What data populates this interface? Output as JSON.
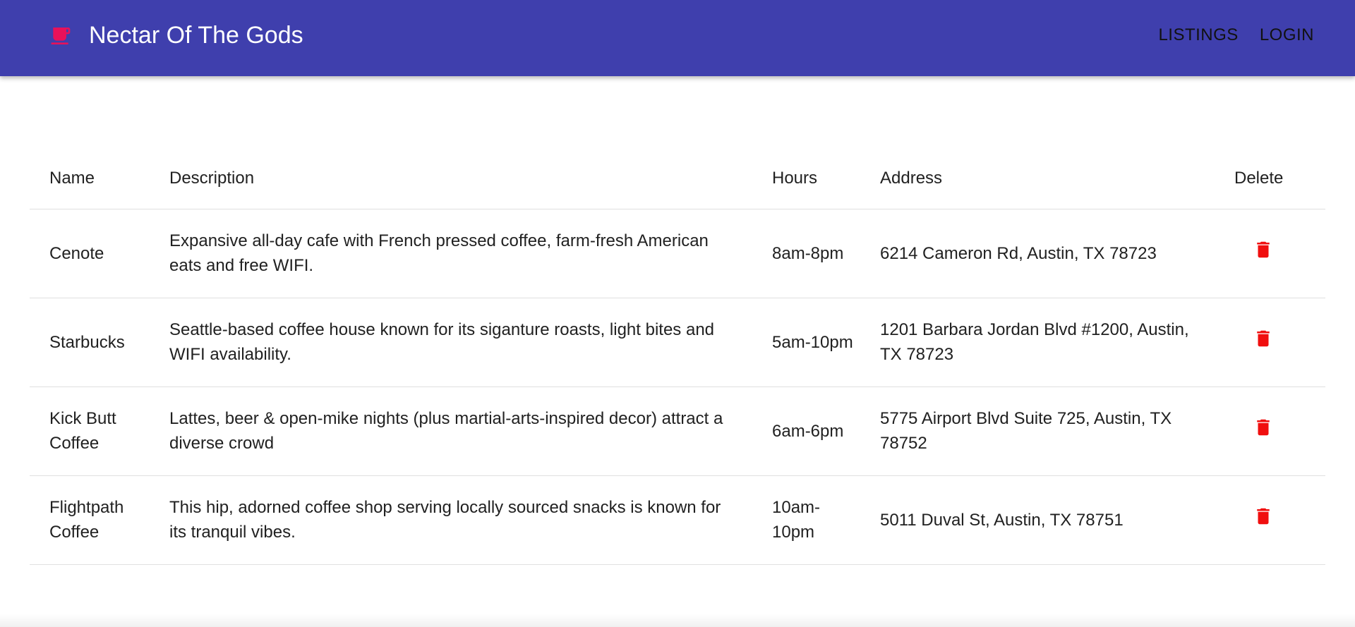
{
  "app": {
    "title": "Nectar Of The Gods",
    "brand_icon": "coffee-cup-icon",
    "colors": {
      "appbar": "#3f3fad",
      "brand_icon": "#e8115a",
      "delete_icon": "#f00f0f"
    }
  },
  "nav": {
    "listings_label": "LISTINGS",
    "login_label": "LOGIN"
  },
  "table": {
    "headers": {
      "name": "Name",
      "description": "Description",
      "hours": "Hours",
      "address": "Address",
      "delete": "Delete"
    },
    "rows": [
      {
        "name": "Cenote",
        "description": "Expansive all-day cafe with French pressed coffee, farm-fresh American eats and free WIFI.",
        "hours": "8am-8pm",
        "address": "6214 Cameron Rd, Austin, TX 78723",
        "delete_icon": "trash-icon"
      },
      {
        "name": "Starbucks",
        "description": "Seattle-based coffee house known for its siganture roasts, light bites and WIFI availability.",
        "hours": "5am-10pm",
        "address": "1201 Barbara Jordan Blvd #1200, Austin, TX 78723",
        "delete_icon": "trash-icon"
      },
      {
        "name": "Kick Butt Coffee",
        "description": "Lattes, beer & open-mike nights (plus martial-arts-inspired decor) attract a diverse crowd",
        "hours": "6am-6pm",
        "address": "5775 Airport Blvd Suite 725, Austin, TX 78752",
        "delete_icon": "trash-icon"
      },
      {
        "name": "Flightpath Coffee",
        "description": "This hip, adorned coffee shop serving locally sourced snacks is known for its tranquil vibes.",
        "hours": "10am-10pm",
        "address": "5011 Duval St, Austin, TX 78751",
        "delete_icon": "trash-icon"
      }
    ]
  }
}
